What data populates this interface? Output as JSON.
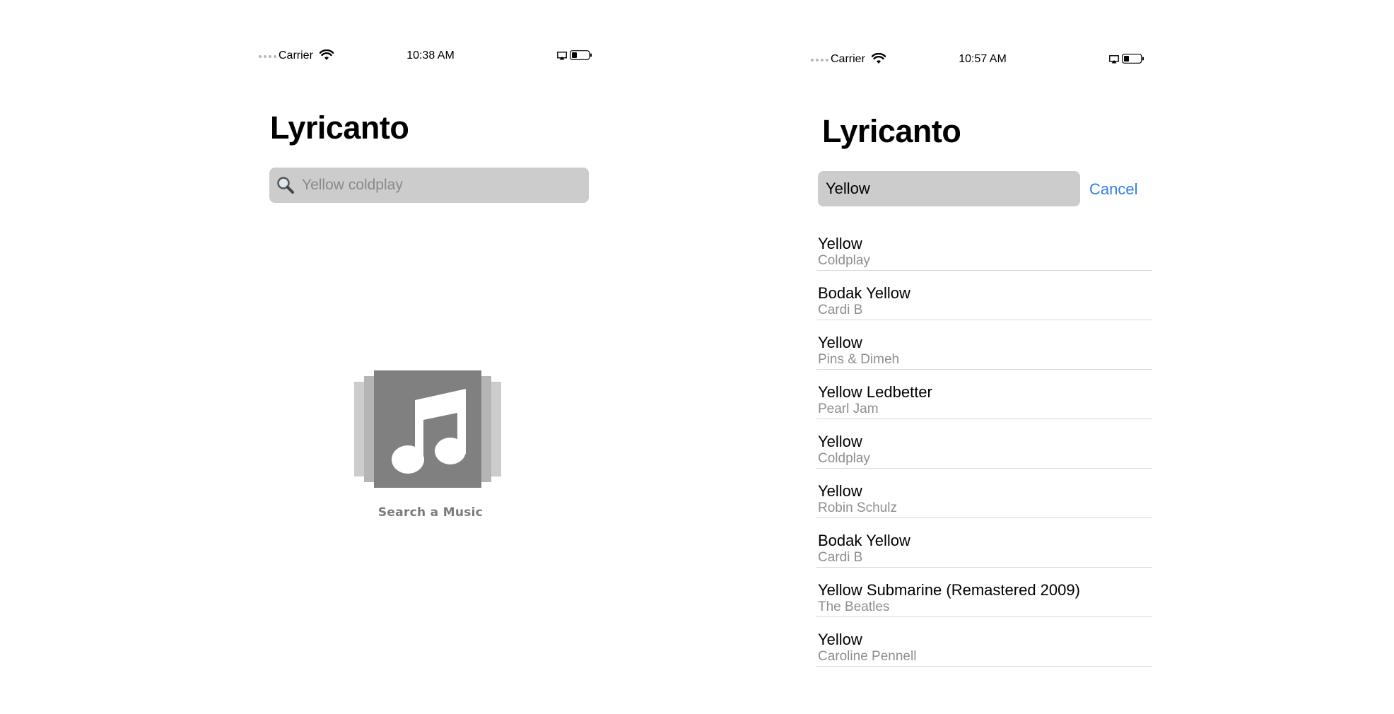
{
  "left_screen": {
    "status_bar": {
      "carrier": "Carrier",
      "time": "10:38 AM"
    },
    "app_title": "Lyricanto",
    "search": {
      "placeholder": "Yellow coldplay"
    },
    "empty_state": {
      "label": "Search a Music",
      "icon": "music-note-icon"
    }
  },
  "right_screen": {
    "status_bar": {
      "carrier": "Carrier",
      "time": "10:57 AM"
    },
    "app_title": "Lyricanto",
    "search": {
      "value": "Yellow",
      "cancel_label": "Cancel"
    },
    "results": [
      {
        "song": "Yellow",
        "artist": "Coldplay"
      },
      {
        "song": "Bodak Yellow",
        "artist": "Cardi B"
      },
      {
        "song": "Yellow",
        "artist": "Pins & Dimeh"
      },
      {
        "song": "Yellow Ledbetter",
        "artist": "Pearl Jam"
      },
      {
        "song": "Yellow",
        "artist": "Coldplay"
      },
      {
        "song": "Yellow",
        "artist": "Robin Schulz"
      },
      {
        "song": "Bodak Yellow",
        "artist": "Cardi B"
      },
      {
        "song": "Yellow Submarine (Remastered 2009)",
        "artist": "The Beatles"
      },
      {
        "song": "Yellow",
        "artist": "Caroline Pennell"
      }
    ]
  },
  "colors": {
    "accent": "#2f7ee6",
    "search_field_bg": "#cccccc",
    "artist_text": "#8e8e8e",
    "icon_gray": "#808080"
  }
}
